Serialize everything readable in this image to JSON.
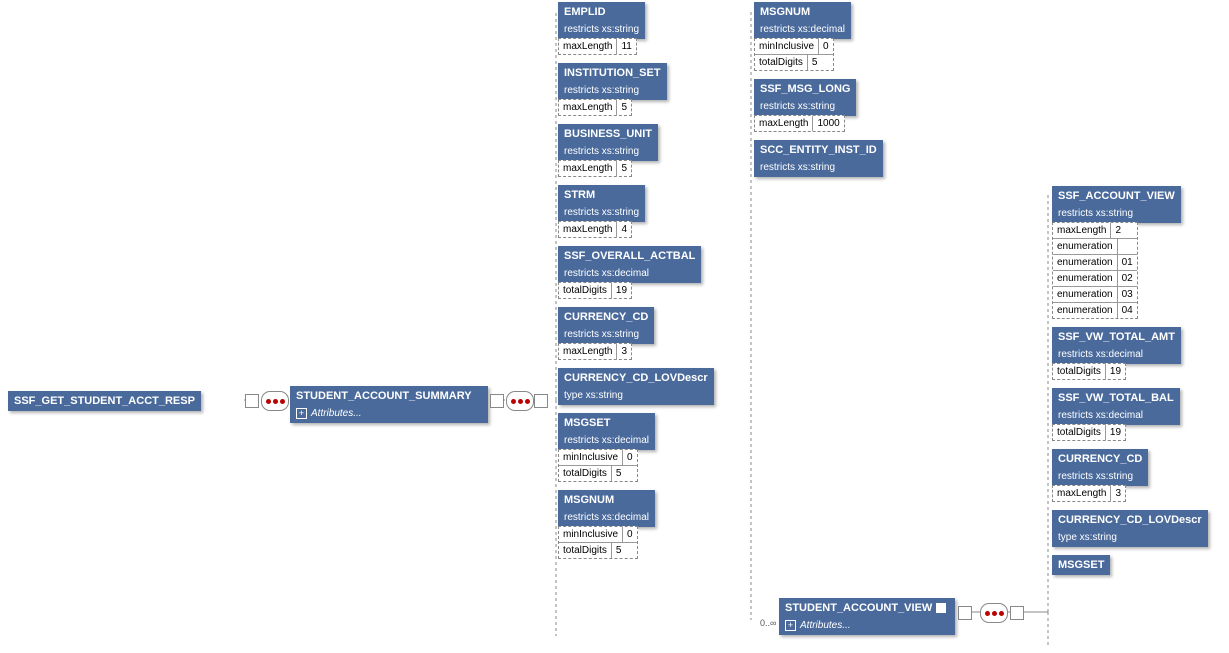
{
  "root": {
    "label": "SSF_GET_STUDENT_ACCT_RESP"
  },
  "summary": {
    "label": "STUDENT_ACCOUNT_SUMMARY",
    "attributes": "Attributes..."
  },
  "view": {
    "label": "STUDENT_ACCOUNT_VIEW",
    "attributes": "Attributes...",
    "multiplicity": "0..∞"
  },
  "col1": {
    "emplid": {
      "title": "EMPLID",
      "restricts": "restricts xs:string",
      "facets": [
        [
          "maxLength",
          "11"
        ]
      ]
    },
    "institution_set": {
      "title": "INSTITUTION_SET",
      "restricts": "restricts xs:string",
      "facets": [
        [
          "maxLength",
          "5"
        ]
      ]
    },
    "business_unit": {
      "title": "BUSINESS_UNIT",
      "restricts": "restricts xs:string",
      "facets": [
        [
          "maxLength",
          "5"
        ]
      ]
    },
    "strm": {
      "title": "STRM",
      "restricts": "restricts xs:string",
      "facets": [
        [
          "maxLength",
          "4"
        ]
      ]
    },
    "overall_actbal": {
      "title": "SSF_OVERALL_ACTBAL",
      "restricts": "restricts xs:decimal",
      "facets": [
        [
          "totalDigits",
          "19"
        ]
      ]
    },
    "currency_cd": {
      "title": "CURRENCY_CD",
      "restricts": "restricts xs:string",
      "facets": [
        [
          "maxLength",
          "3"
        ]
      ]
    },
    "currency_lov": {
      "title": "CURRENCY_CD_LOVDescr",
      "restricts": "type xs:string"
    },
    "msgset": {
      "title": "MSGSET",
      "restricts": "restricts xs:decimal",
      "facets": [
        [
          "minInclusive",
          "0"
        ],
        [
          "totalDigits",
          "5"
        ]
      ]
    },
    "msgnum": {
      "title": "MSGNUM",
      "restricts": "restricts xs:decimal",
      "facets": [
        [
          "minInclusive",
          "0"
        ],
        [
          "totalDigits",
          "5"
        ]
      ]
    }
  },
  "col2": {
    "msgnum": {
      "title": "MSGNUM",
      "restricts": "restricts xs:decimal",
      "facets": [
        [
          "minInclusive",
          "0"
        ],
        [
          "totalDigits",
          "5"
        ]
      ]
    },
    "ssf_msg_long": {
      "title": "SSF_MSG_LONG",
      "restricts": "restricts xs:string",
      "facets": [
        [
          "maxLength",
          "1000"
        ]
      ]
    },
    "entity_id": {
      "title": "SCC_ENTITY_INST_ID",
      "restricts": "restricts xs:string"
    }
  },
  "col3": {
    "account_view": {
      "title": "SSF_ACCOUNT_VIEW",
      "restricts": "restricts xs:string",
      "facets": [
        [
          "maxLength",
          "2"
        ],
        [
          "enumeration",
          ""
        ],
        [
          "enumeration",
          "01"
        ],
        [
          "enumeration",
          "02"
        ],
        [
          "enumeration",
          "03"
        ],
        [
          "enumeration",
          "04"
        ]
      ]
    },
    "vw_total_amt": {
      "title": "SSF_VW_TOTAL_AMT",
      "restricts": "restricts xs:decimal",
      "facets": [
        [
          "totalDigits",
          "19"
        ]
      ]
    },
    "vw_total_bal": {
      "title": "SSF_VW_TOTAL_BAL",
      "restricts": "restricts xs:decimal",
      "facets": [
        [
          "totalDigits",
          "19"
        ]
      ]
    },
    "currency_cd": {
      "title": "CURRENCY_CD",
      "restricts": "restricts xs:string",
      "facets": [
        [
          "maxLength",
          "3"
        ]
      ]
    },
    "currency_lov": {
      "title": "CURRENCY_CD_LOVDescr",
      "restricts": "type xs:string"
    },
    "msgset": {
      "title": "MSGSET"
    }
  }
}
